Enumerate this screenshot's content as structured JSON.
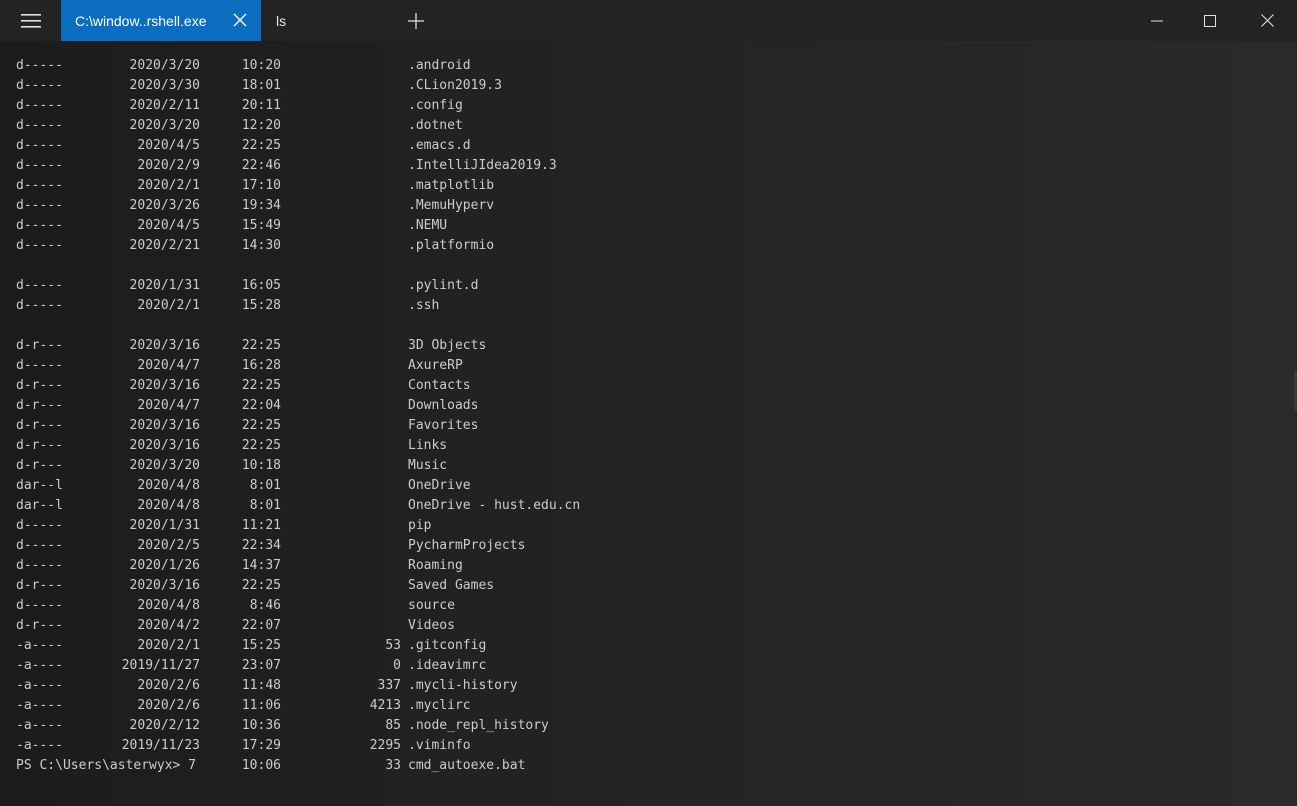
{
  "titlebar": {
    "menu_icon": "hamburger-icon",
    "active_tab_title": "C:\\window..rshell.exe",
    "inactive_tab_title": "ls",
    "close_icon": "close-icon",
    "new_tab_icon": "plus-icon",
    "minimize_icon": "minimize-icon",
    "maximize_icon": "maximize-icon",
    "window_close_icon": "close-icon"
  },
  "colors": {
    "active_tab": "#0b6dc0",
    "titlebar_bg": "#232323",
    "terminal_bg": "#1f1f1f",
    "text": "#cccccc"
  },
  "terminal": {
    "entries": [
      {
        "mode": "d-----",
        "date": "2020/3/20",
        "time": "10:20",
        "length": "",
        "name": ".android"
      },
      {
        "mode": "d-----",
        "date": "2020/3/30",
        "time": "18:01",
        "length": "",
        "name": ".CLion2019.3"
      },
      {
        "mode": "d-----",
        "date": "2020/2/11",
        "time": "20:11",
        "length": "",
        "name": ".config"
      },
      {
        "mode": "d-----",
        "date": "2020/3/20",
        "time": "12:20",
        "length": "",
        "name": ".dotnet"
      },
      {
        "mode": "d-----",
        "date": "2020/4/5",
        "time": "22:25",
        "length": "",
        "name": ".emacs.d"
      },
      {
        "mode": "d-----",
        "date": "2020/2/9",
        "time": "22:46",
        "length": "",
        "name": ".IntelliJIdea2019.3"
      },
      {
        "mode": "d-----",
        "date": "2020/2/1",
        "time": "17:10",
        "length": "",
        "name": ".matplotlib"
      },
      {
        "mode": "d-----",
        "date": "2020/3/26",
        "time": "19:34",
        "length": "",
        "name": ".MemuHyperv"
      },
      {
        "mode": "d-----",
        "date": "2020/4/5",
        "time": "15:49",
        "length": "",
        "name": ".NEMU"
      },
      {
        "mode": "d-----",
        "date": "2020/2/21",
        "time": "14:30",
        "length": "",
        "name": ".platformio"
      },
      {
        "mode": "d-----",
        "date": "2020/1/31",
        "time": "16:05",
        "length": "",
        "name": ".pylint.d"
      },
      {
        "mode": "d-----",
        "date": "2020/2/1",
        "time": "15:28",
        "length": "",
        "name": ".ssh"
      },
      {
        "mode": "d-r---",
        "date": "2020/3/16",
        "time": "22:25",
        "length": "",
        "name": "3D Objects"
      },
      {
        "mode": "d-----",
        "date": "2020/4/7",
        "time": "16:28",
        "length": "",
        "name": "AxureRP"
      },
      {
        "mode": "d-r---",
        "date": "2020/3/16",
        "time": "22:25",
        "length": "",
        "name": "Contacts"
      },
      {
        "mode": "d-r---",
        "date": "2020/4/7",
        "time": "22:04",
        "length": "",
        "name": "Downloads"
      },
      {
        "mode": "d-r---",
        "date": "2020/3/16",
        "time": "22:25",
        "length": "",
        "name": "Favorites"
      },
      {
        "mode": "d-r---",
        "date": "2020/3/16",
        "time": "22:25",
        "length": "",
        "name": "Links"
      },
      {
        "mode": "d-r---",
        "date": "2020/3/20",
        "time": "10:18",
        "length": "",
        "name": "Music"
      },
      {
        "mode": "dar--l",
        "date": "2020/4/8",
        "time": "8:01",
        "length": "",
        "name": "OneDrive"
      },
      {
        "mode": "dar--l",
        "date": "2020/4/8",
        "time": "8:01",
        "length": "",
        "name": "OneDrive - hust.edu.cn"
      },
      {
        "mode": "d-----",
        "date": "2020/1/31",
        "time": "11:21",
        "length": "",
        "name": "pip"
      },
      {
        "mode": "d-----",
        "date": "2020/2/5",
        "time": "22:34",
        "length": "",
        "name": "PycharmProjects"
      },
      {
        "mode": "d-----",
        "date": "2020/1/26",
        "time": "14:37",
        "length": "",
        "name": "Roaming"
      },
      {
        "mode": "d-r---",
        "date": "2020/3/16",
        "time": "22:25",
        "length": "",
        "name": "Saved Games"
      },
      {
        "mode": "d-----",
        "date": "2020/4/8",
        "time": "8:46",
        "length": "",
        "name": "source"
      },
      {
        "mode": "d-r---",
        "date": "2020/4/2",
        "time": "22:07",
        "length": "",
        "name": "Videos"
      },
      {
        "mode": "-a----",
        "date": "2020/2/1",
        "time": "15:25",
        "length": "53",
        "name": ".gitconfig"
      },
      {
        "mode": "-a----",
        "date": "2019/11/27",
        "time": "23:07",
        "length": "0",
        "name": ".ideavimrc"
      },
      {
        "mode": "-a----",
        "date": "2020/2/6",
        "time": "11:48",
        "length": "337",
        "name": ".mycli-history"
      },
      {
        "mode": "-a----",
        "date": "2020/2/6",
        "time": "11:06",
        "length": "4213",
        "name": ".myclirc"
      },
      {
        "mode": "-a----",
        "date": "2020/2/12",
        "time": "10:36",
        "length": "85",
        "name": ".node_repl_history"
      },
      {
        "mode": "-a----",
        "date": "2019/11/23",
        "time": "17:29",
        "length": "2295",
        "name": ".viminfo"
      }
    ],
    "last_line": {
      "prompt": "PS C:\\Users\\asterwyx> 7",
      "time": "10:06",
      "length": "33",
      "name": "cmd_autoexe.bat"
    }
  }
}
